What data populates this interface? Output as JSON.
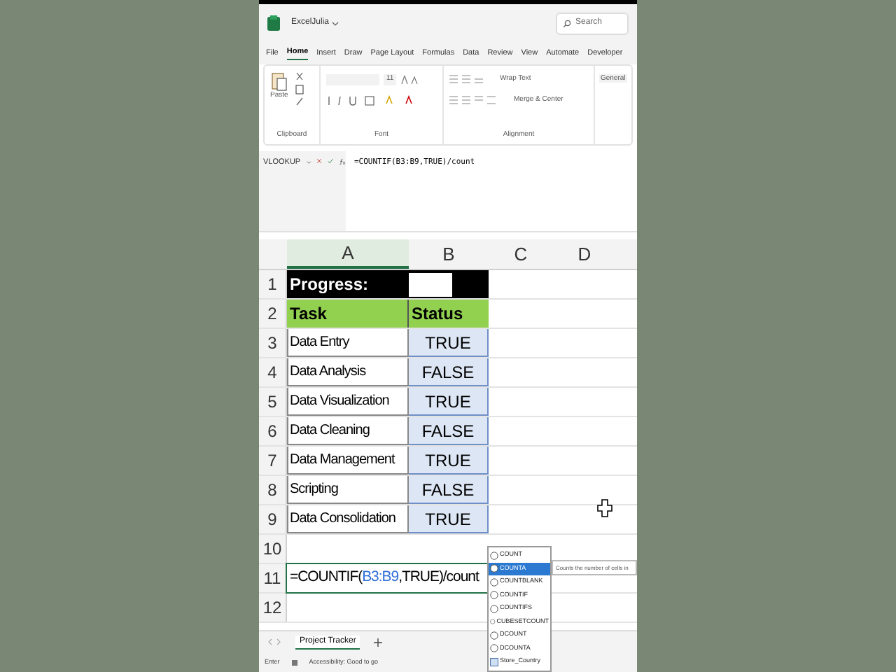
{
  "app": {
    "file_name": "ExcelJulia",
    "search_placeholder": "Search"
  },
  "menu_tabs": [
    {
      "label": "File",
      "selected": false
    },
    {
      "label": "Home",
      "selected": true
    },
    {
      "label": "Insert",
      "selected": false
    },
    {
      "label": "Draw",
      "selected": false
    },
    {
      "label": "Page Layout",
      "selected": false
    },
    {
      "label": "Formulas",
      "selected": false
    },
    {
      "label": "Data",
      "selected": false
    },
    {
      "label": "Review",
      "selected": false
    },
    {
      "label": "View",
      "selected": false
    },
    {
      "label": "Automate",
      "selected": false
    },
    {
      "label": "Developer",
      "selected": false
    }
  ],
  "ribbon": {
    "paste": "Paste",
    "font_size": "11",
    "wrap_text": "Wrap Text",
    "merge_center": "Merge & Center",
    "number_format": "General",
    "groups": [
      "Clipboard",
      "Font",
      "Alignment"
    ]
  },
  "formula_bar": {
    "name_box": "VLOOKUP",
    "formula": "=COUNTIF(B3:B9,TRUE)/count"
  },
  "columns": [
    "A",
    "B",
    "C",
    "D"
  ],
  "rows": [
    {
      "number": "1",
      "kind": "progress",
      "label": "Progress:"
    },
    {
      "number": "2",
      "kind": "header",
      "task": "Task",
      "status": "Status"
    },
    {
      "number": "3",
      "kind": "item",
      "task": "Data Entry",
      "status": "TRUE"
    },
    {
      "number": "4",
      "kind": "item",
      "task": "Data Analysis",
      "status": "FALSE"
    },
    {
      "number": "5",
      "kind": "item",
      "task": "Data Visualization",
      "status": "TRUE"
    },
    {
      "number": "6",
      "kind": "item",
      "task": "Data Cleaning",
      "status": "FALSE"
    },
    {
      "number": "7",
      "kind": "item",
      "task": "Data Management",
      "status": "TRUE"
    },
    {
      "number": "8",
      "kind": "item",
      "task": "Scripting",
      "status": "FALSE"
    },
    {
      "number": "9",
      "kind": "item",
      "task": "Data Consolidation",
      "status": "TRUE"
    },
    {
      "number": "10",
      "kind": "blank"
    },
    {
      "number": "11",
      "kind": "formula",
      "before": "=COUNTIF(",
      "ref": "B3:B9",
      "after": ",TRUE)/count"
    },
    {
      "number": "12",
      "kind": "blank"
    }
  ],
  "autocomplete": {
    "items": [
      {
        "label": "COUNT",
        "kind": "function",
        "selected": false
      },
      {
        "label": "COUNTA",
        "kind": "function",
        "selected": true
      },
      {
        "label": "COUNTBLANK",
        "kind": "function",
        "selected": false
      },
      {
        "label": "COUNTIF",
        "kind": "function",
        "selected": false
      },
      {
        "label": "COUNTIFS",
        "kind": "function",
        "selected": false
      },
      {
        "label": "CUBESETCOUNT",
        "kind": "function",
        "selected": false
      },
      {
        "label": "DCOUNT",
        "kind": "function",
        "selected": false
      },
      {
        "label": "DCOUNTA",
        "kind": "function",
        "selected": false
      },
      {
        "label": "Store_Country",
        "kind": "name",
        "selected": false
      }
    ],
    "tooltip": "Counts the number of cells in"
  },
  "sheet_tabs": [
    {
      "label": "Project Tracker",
      "selected": true
    }
  ],
  "status_bar": {
    "mode": "Enter",
    "accessibility": "Accessibility: Good to go"
  }
}
